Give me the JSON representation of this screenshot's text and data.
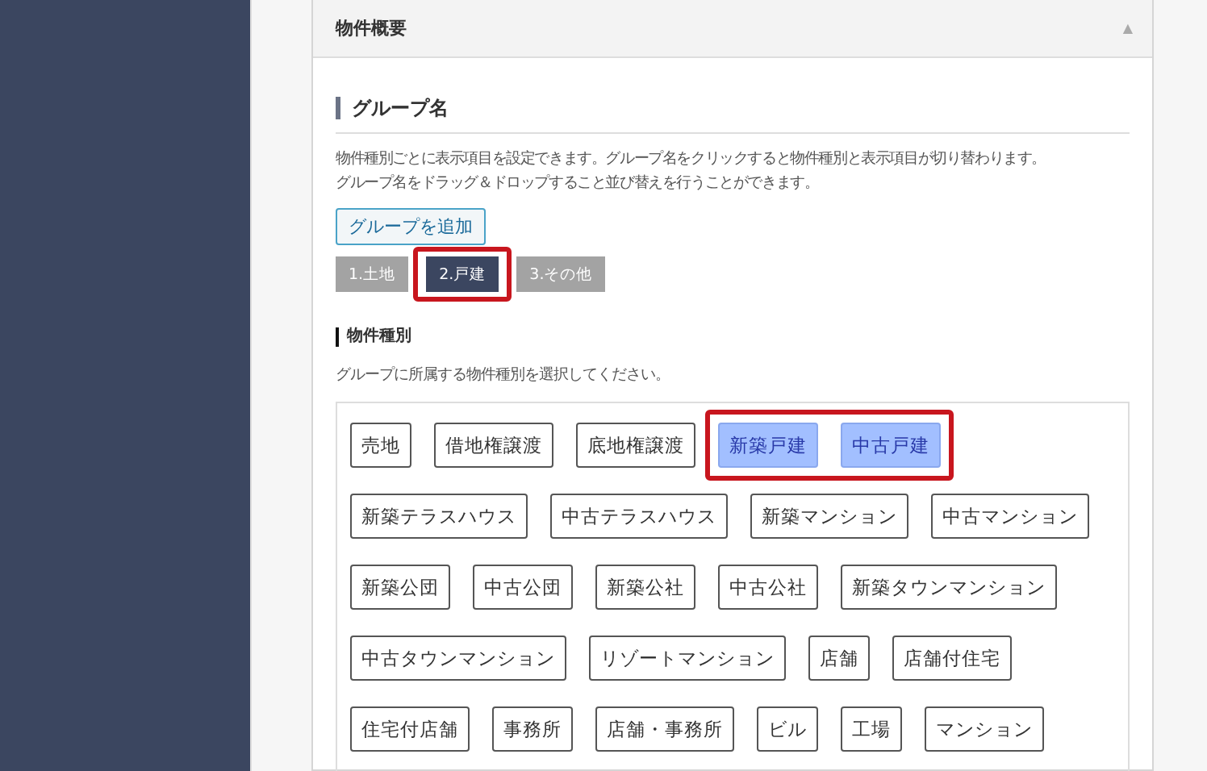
{
  "panel": {
    "title": "物件概要",
    "collapse_icon": "▲"
  },
  "group_section": {
    "heading": "グループ名",
    "description_lines": [
      "物件種別ごとに表示項目を設定できます。グループ名をクリックすると物件種別と表示項目が切り替わります。",
      "グループ名をドラッグ＆ドロップすること並び替えを行うことができます。"
    ],
    "add_button": "グループを追加",
    "tabs": [
      {
        "label": "1.土地",
        "selected": false,
        "highlighted": false
      },
      {
        "label": "2.戸建",
        "selected": true,
        "highlighted": true
      },
      {
        "label": "3.その他",
        "selected": false,
        "highlighted": false
      }
    ]
  },
  "type_section": {
    "heading": "物件種別",
    "description": "グループに所属する物件種別を選択してください。",
    "types": [
      {
        "label": "売地",
        "selected": false,
        "highlighted": false
      },
      {
        "label": "借地権譲渡",
        "selected": false,
        "highlighted": false
      },
      {
        "label": "底地権譲渡",
        "selected": false,
        "highlighted": false
      },
      {
        "label": "新築戸建",
        "selected": true,
        "highlighted": true
      },
      {
        "label": "中古戸建",
        "selected": true,
        "highlighted": true
      },
      {
        "label": "新築テラスハウス",
        "selected": false,
        "highlighted": false
      },
      {
        "label": "中古テラスハウス",
        "selected": false,
        "highlighted": false
      },
      {
        "label": "新築マンション",
        "selected": false,
        "highlighted": false
      },
      {
        "label": "中古マンション",
        "selected": false,
        "highlighted": false
      },
      {
        "label": "新築公団",
        "selected": false,
        "highlighted": false
      },
      {
        "label": "中古公団",
        "selected": false,
        "highlighted": false
      },
      {
        "label": "新築公社",
        "selected": false,
        "highlighted": false
      },
      {
        "label": "中古公社",
        "selected": false,
        "highlighted": false
      },
      {
        "label": "新築タウンマンション",
        "selected": false,
        "highlighted": false
      },
      {
        "label": "中古タウンマンション",
        "selected": false,
        "highlighted": false
      },
      {
        "label": "リゾートマンション",
        "selected": false,
        "highlighted": false
      },
      {
        "label": "店舗",
        "selected": false,
        "highlighted": false
      },
      {
        "label": "店舗付住宅",
        "selected": false,
        "highlighted": false
      },
      {
        "label": "住宅付店舗",
        "selected": false,
        "highlighted": false
      },
      {
        "label": "事務所",
        "selected": false,
        "highlighted": false
      },
      {
        "label": "店舗・事務所",
        "selected": false,
        "highlighted": false
      },
      {
        "label": "ビル",
        "selected": false,
        "highlighted": false
      },
      {
        "label": "工場",
        "selected": false,
        "highlighted": false
      },
      {
        "label": "マンション",
        "selected": false,
        "highlighted": false
      }
    ]
  }
}
